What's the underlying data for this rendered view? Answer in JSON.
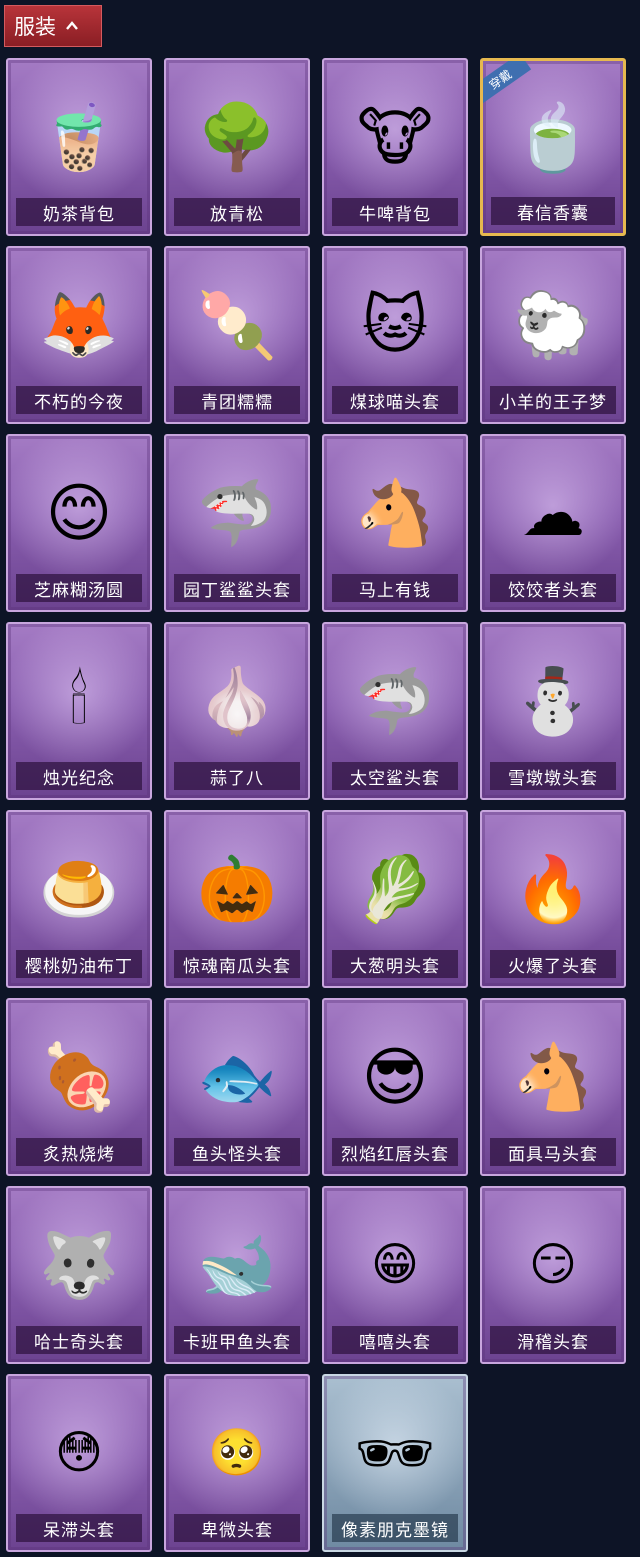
{
  "section": {
    "title": "服装"
  },
  "items": [
    {
      "label": "奶茶背包",
      "icon": "milk-tea-backpack",
      "glyph": "🧋"
    },
    {
      "label": "放青松",
      "icon": "bonsai-pine",
      "glyph": "🌳"
    },
    {
      "label": "牛啤背包",
      "icon": "cow-beer-barrel",
      "glyph": "🐮"
    },
    {
      "label": "春信香囊",
      "icon": "spring-sachet",
      "glyph": "🍵",
      "badge": "穿戴"
    },
    {
      "label": "不朽的今夜",
      "icon": "fox-parfait",
      "glyph": "🦊"
    },
    {
      "label": "青团糯糯",
      "icon": "green-dumpling",
      "glyph": "🍡"
    },
    {
      "label": "煤球喵头套",
      "icon": "black-cat-head",
      "glyph": "🐱"
    },
    {
      "label": "小羊的王子梦",
      "icon": "sheep-prince",
      "glyph": "🐑"
    },
    {
      "label": "芝麻糊汤圆",
      "icon": "sesame-tangyuan",
      "glyph": "😊"
    },
    {
      "label": "园丁鲨鲨头套",
      "icon": "gardener-shark",
      "glyph": "🦈"
    },
    {
      "label": "马上有钱",
      "icon": "red-horse",
      "glyph": "🐴"
    },
    {
      "label": "饺饺者头套",
      "icon": "dumpling-cloud",
      "glyph": "☁"
    },
    {
      "label": "烛光纪念",
      "icon": "candle",
      "glyph": "🕯"
    },
    {
      "label": "蒜了八",
      "icon": "garlic",
      "glyph": "🧄"
    },
    {
      "label": "太空鲨头套",
      "icon": "space-shark",
      "glyph": "🦈"
    },
    {
      "label": "雪墩墩头套",
      "icon": "snowman-reindeer",
      "glyph": "⛄"
    },
    {
      "label": "樱桃奶油布丁",
      "icon": "cherry-pudding",
      "glyph": "🍮"
    },
    {
      "label": "惊魂南瓜头套",
      "icon": "pumpkin",
      "glyph": "🎃"
    },
    {
      "label": "大葱明头套",
      "icon": "scallion",
      "glyph": "🥬"
    },
    {
      "label": "火爆了头套",
      "icon": "fire-spirit",
      "glyph": "🔥"
    },
    {
      "label": "炙热烧烤",
      "icon": "bbq-meat",
      "glyph": "🍖"
    },
    {
      "label": "鱼头怪头套",
      "icon": "fish-head",
      "glyph": "🐟"
    },
    {
      "label": "烈焰红唇头套",
      "icon": "yellow-mouse-sunglasses",
      "glyph": "😎"
    },
    {
      "label": "面具马头套",
      "icon": "horse-mask",
      "glyph": "🐴"
    },
    {
      "label": "哈士奇头套",
      "icon": "husky-sunglasses",
      "glyph": "🐺"
    },
    {
      "label": "卡班甲鱼头套",
      "icon": "whale-head",
      "glyph": "🐋"
    },
    {
      "label": "嘻嘻头套",
      "icon": "grin-emoji",
      "glyph": "😁"
    },
    {
      "label": "滑稽头套",
      "icon": "funny-emoji",
      "glyph": "😏"
    },
    {
      "label": "呆滞头套",
      "icon": "blank-stare-emoji",
      "glyph": "😳"
    },
    {
      "label": "卑微头套",
      "icon": "pleading-emoji",
      "glyph": "🥺"
    },
    {
      "label": "像素朋克墨镜",
      "icon": "pixel-sunglasses",
      "glyph": "🕶"
    }
  ],
  "colors": {
    "background": "#0d1426",
    "tab": "#a0282e",
    "card": "#8a5fb0",
    "card_blue": "#8ba3b8",
    "selected_border": "#e6b94f",
    "badge": "#3f6fb0"
  }
}
